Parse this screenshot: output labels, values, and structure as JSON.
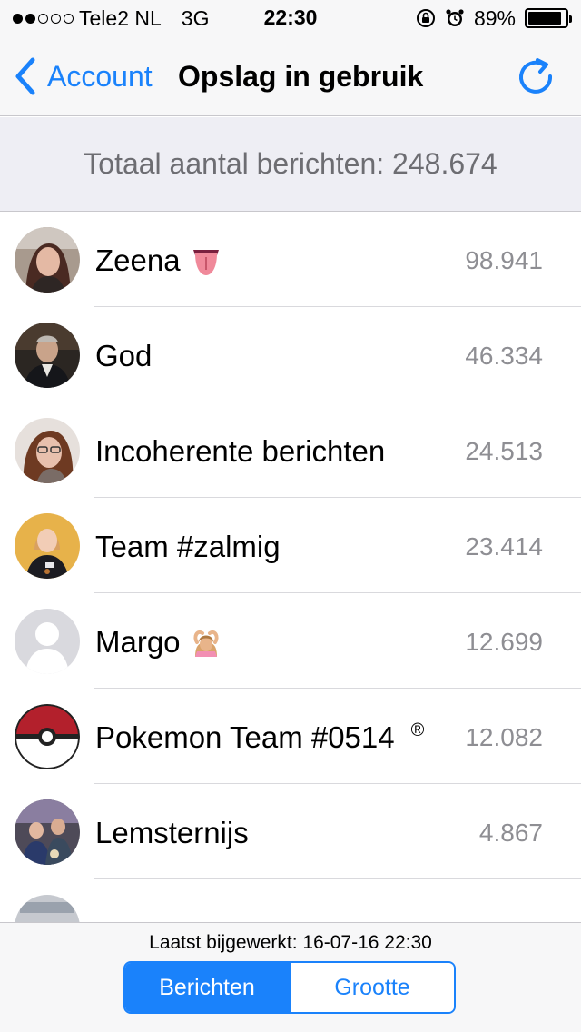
{
  "status_bar": {
    "signal_dots_filled": 2,
    "signal_dots_total": 5,
    "carrier": "Tele2 NL",
    "network": "3G",
    "time": "22:30",
    "battery_percent": "89%",
    "battery_level": 0.89
  },
  "nav": {
    "back_label": "Account",
    "title": "Opslag in gebruik"
  },
  "summary": {
    "total_text": "Totaal aantal berichten: 248.674"
  },
  "chats": [
    {
      "name": "Zeena",
      "count": "98.941",
      "emoji": "tongue-emoji"
    },
    {
      "name": "God",
      "count": "46.334"
    },
    {
      "name": "Incoherente berichten",
      "count": "24.513"
    },
    {
      "name": "Team #zalmig",
      "count": "23.414"
    },
    {
      "name": "Margo",
      "count": "12.699",
      "emoji": "raising-hands-woman-emoji"
    },
    {
      "name": "Pokemon Team #0514",
      "suffix": "®",
      "count": "12.082"
    },
    {
      "name": "Lemsternijs",
      "count": "4.867"
    }
  ],
  "footer": {
    "last_updated": "Laatst bijgewerkt: 16-07-16 22:30",
    "segments": [
      "Berichten",
      "Grootte"
    ],
    "selected_segment": "Berichten"
  },
  "colors": {
    "accent": "#1a82fb",
    "header_bg": "#eeeef4",
    "count_text": "#8e8e93"
  }
}
